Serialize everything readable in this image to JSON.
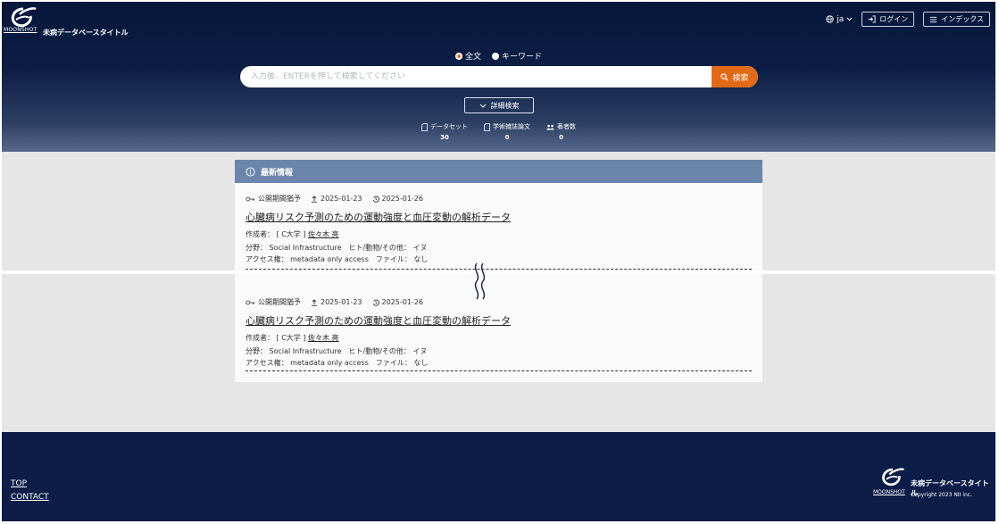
{
  "brand": {
    "logo_word": "MOONSHOT",
    "site_title": "未病データベースタイトル"
  },
  "header": {
    "language": "ja",
    "login_label": "ログイン",
    "index_label": "インデックス",
    "search_modes": [
      "全文",
      "キーワード"
    ],
    "selected_mode": "全文",
    "search_placeholder": "入力後、ENTERを押して検索してください",
    "search_button": "検索",
    "advanced_search": "詳細検索",
    "stats": [
      {
        "label": "データセット",
        "value": "30",
        "icon": "document-icon"
      },
      {
        "label": "学術雑誌論文",
        "value": "0",
        "icon": "document-icon"
      },
      {
        "label": "著者数",
        "value": "0",
        "icon": "people-icon"
      }
    ]
  },
  "panel": {
    "title": "最新情報",
    "items": [
      {
        "access_status": "公開期間猶予",
        "uploaded": "2025-01-23",
        "updated": "2025-01-26",
        "title": "心臓病リスク予測のための運動強度と血圧変動の解析データ",
        "creator_label": "作成者：",
        "affiliation": "[ C大学 ]",
        "creator": "佐々木 亮",
        "field": "分野： Social Infrastructure　ヒト/動物/その他： イヌ",
        "access": "アクセス権： metadata only access　ファイル： なし"
      },
      {
        "access_status": "公開期間猶予",
        "uploaded": "2025-01-23",
        "updated": "2025-01-26",
        "title": "心臓病リスク予測のための運動強度と血圧変動の解析データ",
        "creator_label": "作成者：",
        "affiliation": "[ C大学 ]",
        "creator": "佐々木 亮",
        "field": "分野： Social Infrastructure　ヒト/動物/その他： イヌ",
        "access": "アクセス権： metadata only access　ファイル： なし"
      }
    ]
  },
  "footer": {
    "links": [
      "TOP",
      "CONTACT"
    ],
    "site_title": "未病データベースタイトル",
    "copyright": "Copyright 2023 NII inc.",
    "logo_word": "MOONSHOT"
  },
  "colors": {
    "header_dark": "#07173a",
    "accent": "#e26a17",
    "panel_head": "#6b86aa",
    "footer": "#0c1d47"
  }
}
